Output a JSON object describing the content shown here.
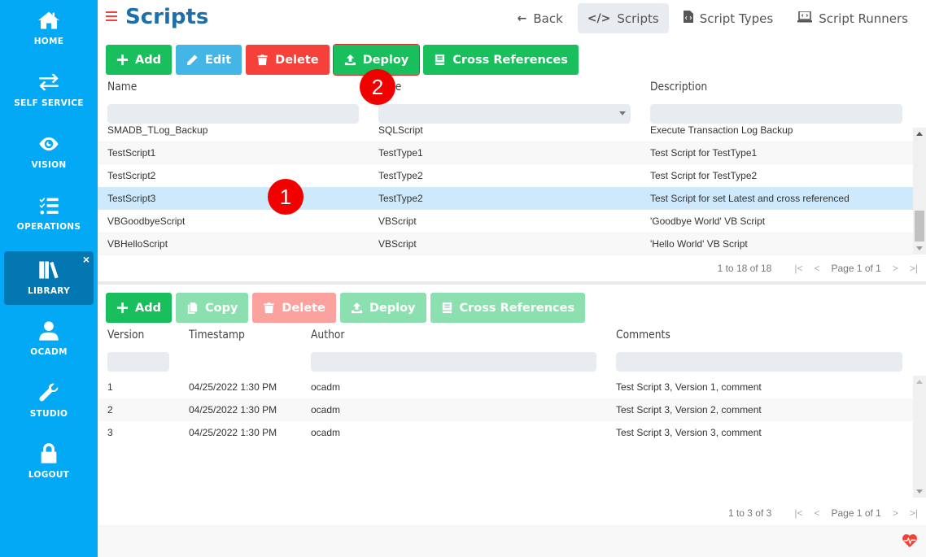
{
  "sidebar": {
    "items": [
      {
        "label": "HOME",
        "icon": "home-icon"
      },
      {
        "label": "SELF SERVICE",
        "icon": "exchange-icon"
      },
      {
        "label": "VISION",
        "icon": "eye-icon"
      },
      {
        "label": "OPERATIONS",
        "icon": "tasks-list-icon"
      },
      {
        "label": "LIBRARY",
        "icon": "books-icon",
        "active": true,
        "close": "×"
      },
      {
        "label": "OCADM",
        "icon": "user-icon"
      },
      {
        "label": "STUDIO",
        "icon": "wrench-icon"
      },
      {
        "label": "LOGOUT",
        "icon": "lock-icon"
      }
    ]
  },
  "header": {
    "title": "Scripts",
    "nav": [
      {
        "label": "Back",
        "icon": "←"
      },
      {
        "label": "Scripts",
        "icon": "</>",
        "active": true
      },
      {
        "label": "Script Types",
        "icon": "file-code-icon"
      },
      {
        "label": "Script Runners",
        "icon": "laptop-code-icon"
      }
    ]
  },
  "scripts_toolbar": {
    "add": "Add",
    "edit": "Edit",
    "delete": "Delete",
    "deploy": "Deploy",
    "cross_references": "Cross References"
  },
  "scripts_grid": {
    "columns": [
      "Name",
      "Type",
      "Description"
    ],
    "rows": [
      {
        "name": "SMADB_TLog_Backup",
        "type": "SQLScript",
        "description": "Execute Transaction Log Backup"
      },
      {
        "name": "TestScript1",
        "type": "TestType1",
        "description": "Test Script for TestType1"
      },
      {
        "name": "TestScript2",
        "type": "TestType2",
        "description": "Test Script for TestType2"
      },
      {
        "name": "TestScript3",
        "type": "TestType2",
        "description": "Test Script for set Latest and cross referenced",
        "selected": true
      },
      {
        "name": "VBGoodbyeScript",
        "type": "VBScript",
        "description": "'Goodbye World' VB Script"
      },
      {
        "name": "VBHelloScript",
        "type": "VBScript",
        "description": "'Hello World' VB Script"
      }
    ],
    "pager": {
      "count": "1 to 18 of 18",
      "page": "Page 1 of 1"
    }
  },
  "versions_toolbar": {
    "add": "Add",
    "copy": "Copy",
    "delete": "Delete",
    "deploy": "Deploy",
    "cross_references": "Cross References"
  },
  "versions_grid": {
    "columns": [
      "Version",
      "Timestamp",
      "Author",
      "Comments"
    ],
    "rows": [
      {
        "version": "1",
        "timestamp": "04/25/2022 1:30 PM",
        "author": "ocadm",
        "comments": "Test Script 3, Version 1, comment"
      },
      {
        "version": "2",
        "timestamp": "04/25/2022 1:30 PM",
        "author": "ocadm",
        "comments": "Test Script 3, Version 2, comment"
      },
      {
        "version": "3",
        "timestamp": "04/25/2022 1:30 PM",
        "author": "ocadm",
        "comments": "Test Script 3, Version 3, comment"
      }
    ],
    "pager": {
      "count": "1 to 3 of 3",
      "page": "Page 1 of 1"
    }
  },
  "annotations": {
    "step1": "1",
    "step2": "2"
  },
  "pager_icons": {
    "first": "|<",
    "prev": "<",
    "next": ">",
    "last": ">|"
  }
}
